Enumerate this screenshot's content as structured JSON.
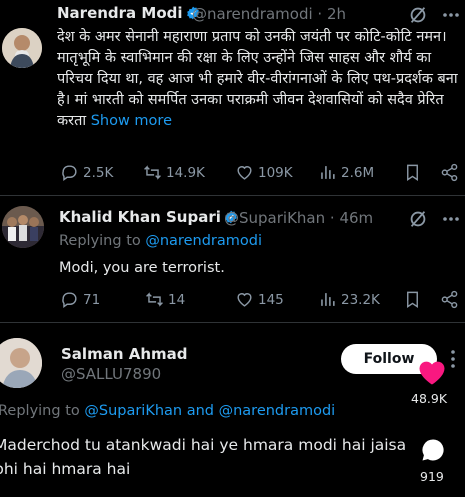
{
  "tweet1": {
    "name": "Narendra Modi",
    "handle": "@narendramodi",
    "time": "· 2h",
    "text": "देश के अमर सेनानी महाराणा प्रताप को उनकी जयंती पर कोटि-कोटि नमन। मातृभूमि के स्वाभिमान की रक्षा के लिए उन्होंने जिस साहस और शौर्य का परिचय दिया था, वह आज भी हमारे वीर-वीरांगनाओं के लिए पथ-प्रदर्शक बना है। मां भारती को समर्पित उनका पराक्रमी जीवन देशवासियों को सदैव प्रेरित करता",
    "show_more": "Show more",
    "replies": "2.5K",
    "retweets": "14.9K",
    "likes": "109K",
    "views": "2.6M"
  },
  "tweet2": {
    "name": "Khalid Khan Supari",
    "handle": "@SupariKhan",
    "time": "· 46m",
    "replying_prefix": "Replying to",
    "replying_handle": "@narendramodi",
    "text": "Modi, you are terrorist.",
    "replies": "71",
    "retweets": "14",
    "likes": "145",
    "views": "23.2K"
  },
  "reply3": {
    "name": "Salman Ahmad",
    "handle": "@SALLU7890",
    "follow_label": "Follow",
    "replying_prefix": "Replying to",
    "replying_handles": "@SupariKhan and @narendramodi",
    "text_line1": "Maderchod tu atankwadi hai ye hmara modi hai jaisa",
    "text_line2": "bhi hai hmara hai",
    "like_count": "48.9K",
    "comment_count": "919"
  },
  "colors": {
    "background": "#000000",
    "text": "#e7e9ea",
    "muted": "#71767b",
    "link": "#1d9bf0",
    "verified": "#1d9bf0",
    "heart": "#f91880"
  }
}
